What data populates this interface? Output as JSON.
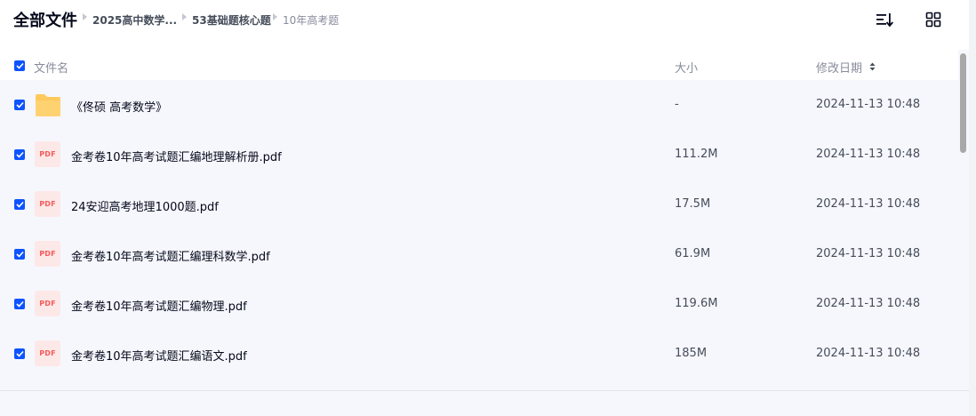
{
  "breadcrumb": {
    "root": "全部文件",
    "items": [
      "2025高中数学...",
      "53基础题核心题",
      "10年高考题"
    ]
  },
  "toolbar": {
    "sort_icon": "sort-list-icon",
    "grid_icon": "grid-view-icon"
  },
  "table": {
    "headers": {
      "name": "文件名",
      "size": "大小",
      "date": "修改日期"
    },
    "rows": [
      {
        "type": "folder",
        "name": "《佟硕 高考数学》",
        "size": "-",
        "date": "2024-11-13 10:48"
      },
      {
        "type": "pdf",
        "name": "金考卷10年高考试题汇编地理解析册.pdf",
        "size": "111.2M",
        "date": "2024-11-13 10:48"
      },
      {
        "type": "pdf",
        "name": "24安迎高考地理1000题.pdf",
        "size": "17.5M",
        "date": "2024-11-13 10:48"
      },
      {
        "type": "pdf",
        "name": "金考卷10年高考试题汇编理科数学.pdf",
        "size": "61.9M",
        "date": "2024-11-13 10:48"
      },
      {
        "type": "pdf",
        "name": "金考卷10年高考试题汇编物理.pdf",
        "size": "119.6M",
        "date": "2024-11-13 10:48"
      },
      {
        "type": "pdf",
        "name": "金考卷10年高考试题汇编语文.pdf",
        "size": "185M",
        "date": "2024-11-13 10:48"
      }
    ]
  },
  "pdf_label": "PDF",
  "colors": {
    "checkbox": "#0d53ff",
    "list_bg": "#f6f7fc",
    "folder": "#ffc95c",
    "pdf_red": "#f45b5b"
  }
}
